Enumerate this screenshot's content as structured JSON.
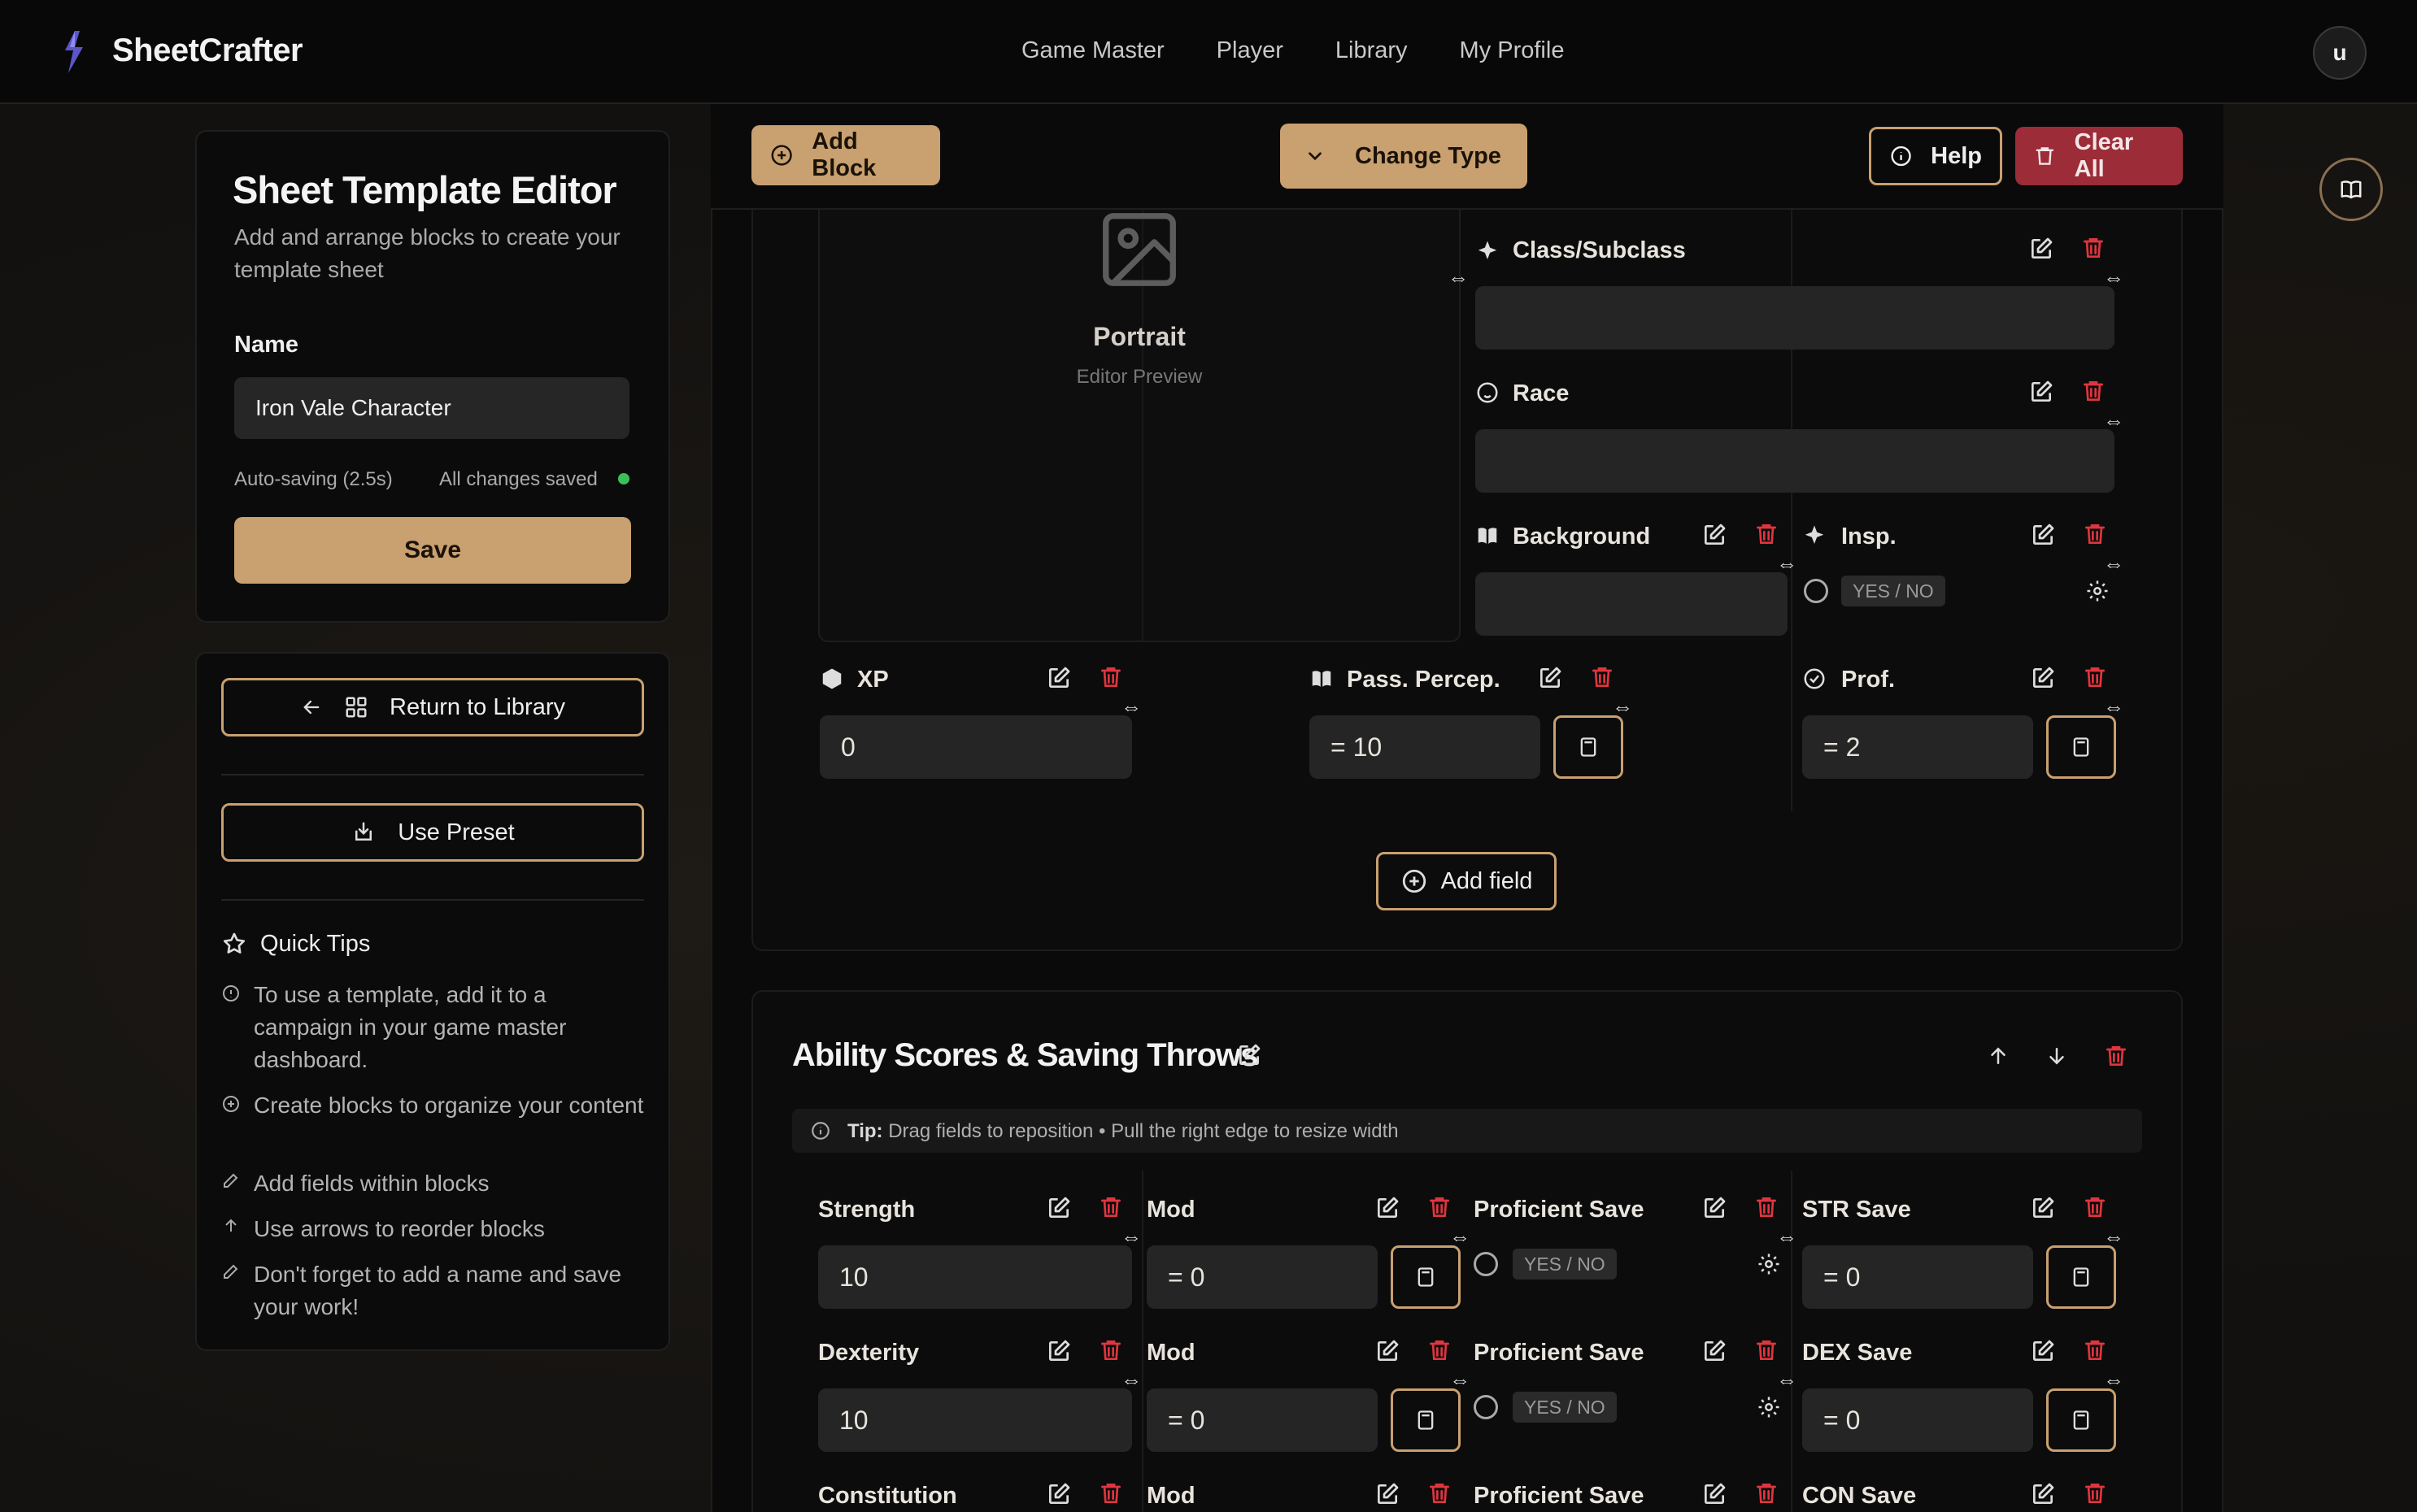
{
  "nav": {
    "brand": "SheetCrafter",
    "links": [
      "Game Master",
      "Player",
      "Library",
      "My Profile"
    ],
    "avatar": "u"
  },
  "sidebar": {
    "title": "Sheet Template Editor",
    "subtitle": "Add and arrange blocks to create your template sheet",
    "name_label": "Name",
    "name_value": "Iron Vale Character",
    "autosave": "Auto-saving (2.5s)",
    "saved_status": "All changes saved",
    "save_label": "Save",
    "return_label": "Return to Library",
    "preset_label": "Use Preset",
    "quick_tips_title": "Quick Tips",
    "tips": [
      "To use a template, add it to a campaign in your game master dashboard.",
      "Create blocks to organize your content",
      "Add fields within blocks",
      "Use arrows to reorder blocks",
      "Don't forget to add a name and save your work!"
    ]
  },
  "toolbar": {
    "add_block": "Add Block",
    "change_type": "Change Type",
    "help": "Help",
    "clear_all": "Clear All"
  },
  "block1": {
    "portrait_title": "Portrait",
    "portrait_sub": "Editor Preview",
    "class_label": "Class/Subclass",
    "race_label": "Race",
    "background_label": "Background",
    "insp_label": "Insp.",
    "yes_no": "YES / NO",
    "xp_label": "XP",
    "xp_value": "0",
    "percep_label": "Pass. Percep.",
    "percep_value": "= 10",
    "prof_label": "Prof.",
    "prof_value": "= 2",
    "add_field": "Add field"
  },
  "block2": {
    "title": "Ability Scores & Saving Throws",
    "tip_prefix": "Tip:",
    "tip_text": "Drag fields to reposition • Pull the right edge to resize width",
    "rows": [
      {
        "ability": "Strength",
        "value": "10",
        "mod_label": "Mod",
        "mod_value": "= 0",
        "prof_label": "Proficient Save",
        "save_label": "STR Save",
        "save_value": "= 0"
      },
      {
        "ability": "Dexterity",
        "value": "10",
        "mod_label": "Mod",
        "mod_value": "= 0",
        "prof_label": "Proficient Save",
        "save_label": "DEX Save",
        "save_value": "= 0"
      },
      {
        "ability": "Constitution",
        "mod_label": "Mod",
        "prof_label": "Proficient Save",
        "save_label": "CON Save"
      }
    ]
  },
  "colors": {
    "accent": "#c9a070",
    "danger": "#e0353f",
    "clear_bg": "#9b2c38",
    "success": "#3cbf5a"
  }
}
